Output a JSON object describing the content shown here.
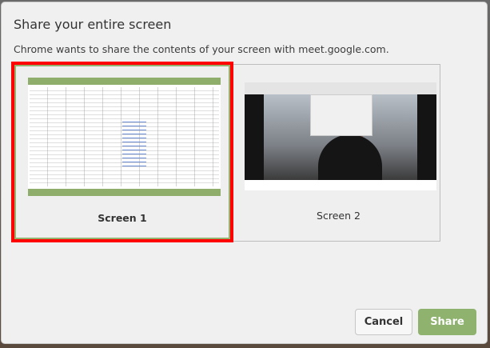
{
  "dialog": {
    "title": "Share your entire screen",
    "subtitle": "Chrome wants to share the contents of your screen with meet.google.com.",
    "screens": [
      {
        "label": "Screen 1",
        "selected": true
      },
      {
        "label": "Screen 2",
        "selected": false
      }
    ],
    "cancel_label": "Cancel",
    "share_label": "Share"
  },
  "colors": {
    "accent": "#8fb26f",
    "selection": "#ff0000"
  }
}
